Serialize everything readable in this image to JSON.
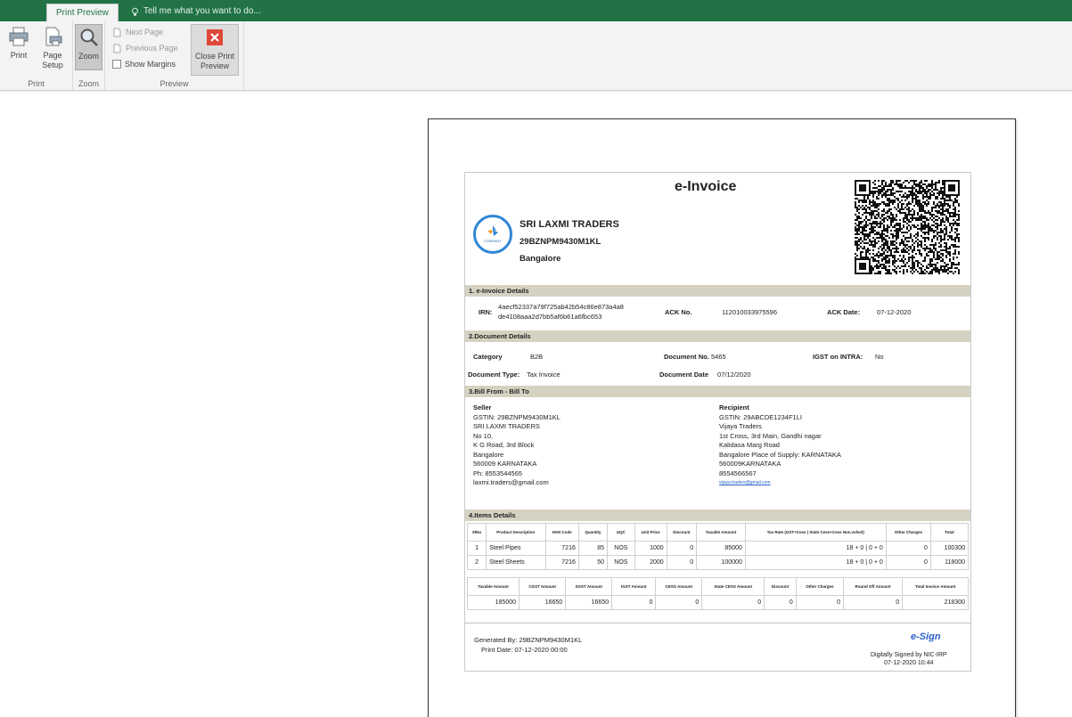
{
  "ribbon": {
    "active_tab": "Print Preview",
    "tell_me": "Tell me what you want to do...",
    "print_label": "Print",
    "page_setup_label": "Page Setup",
    "zoom_label": "Zoom",
    "next_page_label": "Next Page",
    "previous_page_label": "Previous Page",
    "show_margins_label": "Show Margins",
    "close_preview_label": "Close Print Preview",
    "group_print": "Print",
    "group_zoom": "Zoom",
    "group_preview": "Preview"
  },
  "invoice": {
    "title": "e-Invoice",
    "logo_text": "COMPANY",
    "company": "SRI LAXMI TRADERS",
    "gstin": "29BZNPM9430M1KL",
    "city": "Bangalore",
    "sec1": "1. e-Invoice Details",
    "irn_label": "IRN:",
    "irn_line1": "4aecf52337a79f725ab42b54c86e873a4a8",
    "irn_line2": "de4108aaa2d7bb5af6b61a6fbc653",
    "ack_no_label": "ACK No.",
    "ack_no": "112010033975596",
    "ack_date_label": "ACK Date:",
    "ack_date": "07-12-2020",
    "sec2": "2.Document Details",
    "category_label": "Category",
    "category": "B2B",
    "doc_no_label": "Document No.",
    "doc_no": "5465",
    "igst_label": "IGST on INTRA:",
    "igst": "No",
    "doc_type_label": "Document Type:",
    "doc_type": "Tax Invoice",
    "doc_date_label": "Document Date",
    "doc_date": "07/12/2020",
    "sec3": "3.Bill From - Bill To",
    "seller": {
      "head": "Seller",
      "lines": [
        "GSTIN: 29BZNPM9430M1KL",
        "SRI LAXMI TRADERS",
        "No 10,",
        "K G Road, 3rd Block",
        "Bangalore",
        "560009   KARNATAKA",
        "Ph: 8553544565",
        "laxmi.traders@gmail.com"
      ]
    },
    "recipient": {
      "head": "Recipient",
      "lines": [
        "GSTIN:   29ABCDE1234F1LI",
        "Vijaya  Traders",
        "1st Cross, 3rd Main, Gandhi nagar",
        "Kalidasa Marg Road",
        "Bangalore  Place of Supply: KARNATAKA",
        "560009KARNATAKA",
        "8554566567"
      ],
      "email": "vijaya.traders@gmail.com"
    },
    "sec4": "4.Items Details",
    "item_headers": [
      "SlNo",
      "Product Description",
      "HSN Code",
      "Quantity",
      "UQC",
      "Unit Price",
      "Discount",
      "Taxable Amount",
      "Tax Rate (GST+Cess | State Cess+Cess Non.Advol)",
      "Other Charges",
      "Total"
    ],
    "items": [
      [
        "1",
        "Steel Pipes",
        "7216",
        "85",
        "NOS",
        "1000",
        "0",
        "85000",
        "18 + 0 | 0 + 0",
        "0",
        "100300"
      ],
      [
        "2",
        "Steel Sheets",
        "7216",
        "50",
        "NOS",
        "2000",
        "0",
        "100000",
        "18 + 0 | 0 + 0",
        "0",
        "118000"
      ]
    ],
    "total_headers": [
      "Taxable Amount",
      "CGST Amount",
      "SGST Amount",
      "IGST Amount",
      "CESS Amount",
      "State CESS Amount",
      "Discount",
      "Other Charges",
      "Round Off Amount",
      "Total Invoice Amount"
    ],
    "totals": [
      "185000",
      "16650",
      "16650",
      "0",
      "0",
      "0",
      "0",
      "0",
      "0",
      "218300"
    ],
    "generated_by": "Generated By:  29BZNPM9430M1KL",
    "print_date": "Print Date:  07-12-2020 00:00",
    "esign": "e-Sign",
    "signed_by": "Digitally Signed by NIC-IRP",
    "signed_at": "07-12-2020 10:44"
  }
}
